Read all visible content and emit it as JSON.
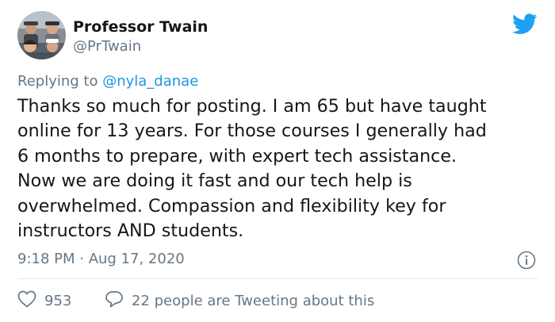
{
  "author": {
    "display_name": "Professor Twain",
    "handle": "@PrTwain",
    "avatar_icon": "profile-photo"
  },
  "reply": {
    "prefix": "Replying to",
    "mention": "@nyla_danae"
  },
  "tweet": {
    "lines": [
      "Thanks so much for posting. I am 65 but have taught",
      "online for 13 years. For those courses I generally had",
      "6 months to prepare, with expert tech assistance.",
      "Now we are doing it fast and our tech help is",
      "overwhelmed. Compassion and flexibility key for",
      "instructors AND students."
    ],
    "timestamp": "9:18 PM · Aug 17, 2020"
  },
  "engagement": {
    "likes": "953",
    "conversation": "22 people are Tweeting about this"
  },
  "icons": {
    "brand": "twitter-bird-icon",
    "info": "info-icon",
    "like": "heart-icon",
    "conversation": "speech-bubble-icon"
  },
  "colors": {
    "twitter_blue": "#1da1f2",
    "mention_blue": "#1b95e0",
    "secondary_text": "#657786",
    "primary_text": "#14171a",
    "divider": "#e1e8ed"
  }
}
